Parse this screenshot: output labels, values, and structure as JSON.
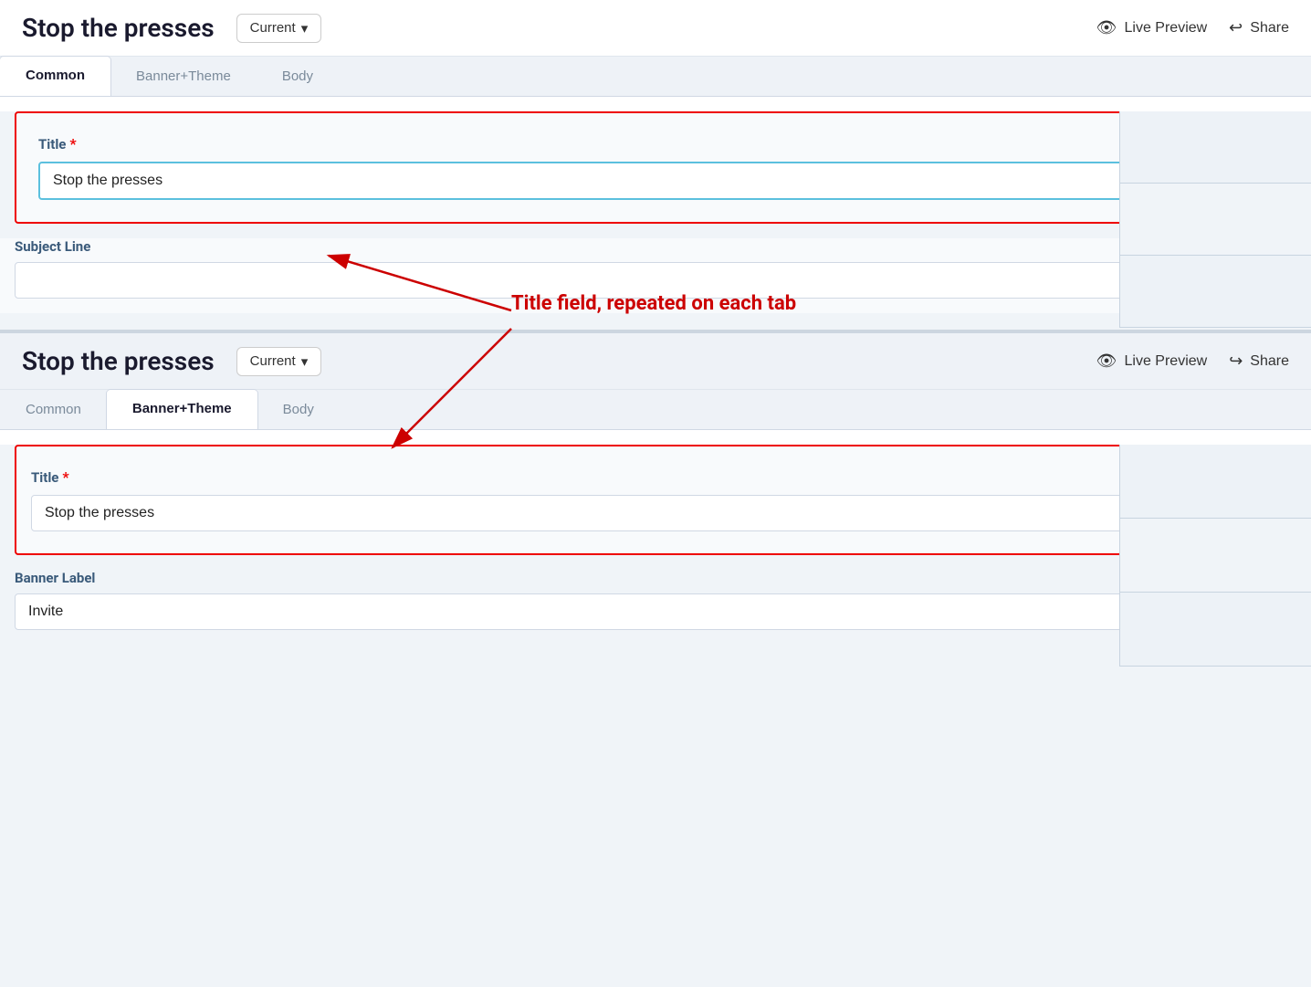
{
  "page": {
    "title": "Stop the presses",
    "version_label": "Current",
    "version_chevron": "▾",
    "live_preview_label": "Live Preview",
    "share_label": "Share"
  },
  "top_panel": {
    "tabs": [
      {
        "label": "Common",
        "active": true
      },
      {
        "label": "Banner+Theme",
        "active": false
      },
      {
        "label": "Body",
        "active": false
      }
    ],
    "title_field": {
      "label": "Title",
      "required": true,
      "value": "Stop the presses",
      "placeholder": ""
    },
    "subject_field": {
      "label": "Subject Line",
      "value": "",
      "placeholder": ""
    }
  },
  "bottom_panel": {
    "title": "Stop the presses",
    "version_label": "Current",
    "version_chevron": "▾",
    "live_preview_label": "Live Preview",
    "share_label": "Share",
    "tabs": [
      {
        "label": "Common",
        "active": false
      },
      {
        "label": "Banner+Theme",
        "active": true
      },
      {
        "label": "Body",
        "active": false
      }
    ],
    "title_field": {
      "label": "Title",
      "required": true,
      "value": "Stop the presses",
      "placeholder": ""
    },
    "banner_label_field": {
      "label": "Banner Label",
      "value": "Invite",
      "placeholder": ""
    }
  },
  "annotation": {
    "text": "Title field, repeated on each tab"
  },
  "icons": {
    "eye": "👁",
    "share": "➦",
    "chevron_down": "▾"
  }
}
